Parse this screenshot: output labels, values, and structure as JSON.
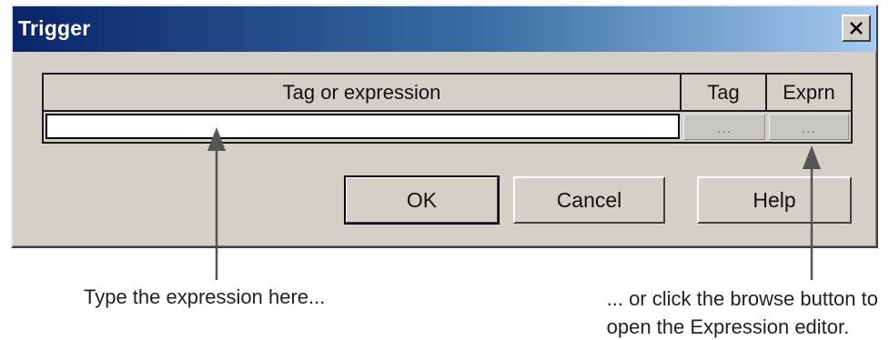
{
  "window": {
    "title": "Trigger",
    "close_icon": "close-icon"
  },
  "grid": {
    "headers": [
      "Tag or expression",
      "Tag",
      "Exprn"
    ],
    "expression_value": "",
    "tag_browse_label": "...",
    "exprn_browse_label": "..."
  },
  "buttons": {
    "ok": "OK",
    "cancel": "Cancel",
    "help": "Help"
  },
  "annotations": {
    "left_caption": "Type the expression here...",
    "right_caption_line1": "... or click the browse button to",
    "right_caption_line2": "open the Expression editor."
  },
  "colors": {
    "dialog_bg": "#d4d0c8",
    "titlebar_start": "#0a246a",
    "titlebar_end": "#a6caf0"
  }
}
